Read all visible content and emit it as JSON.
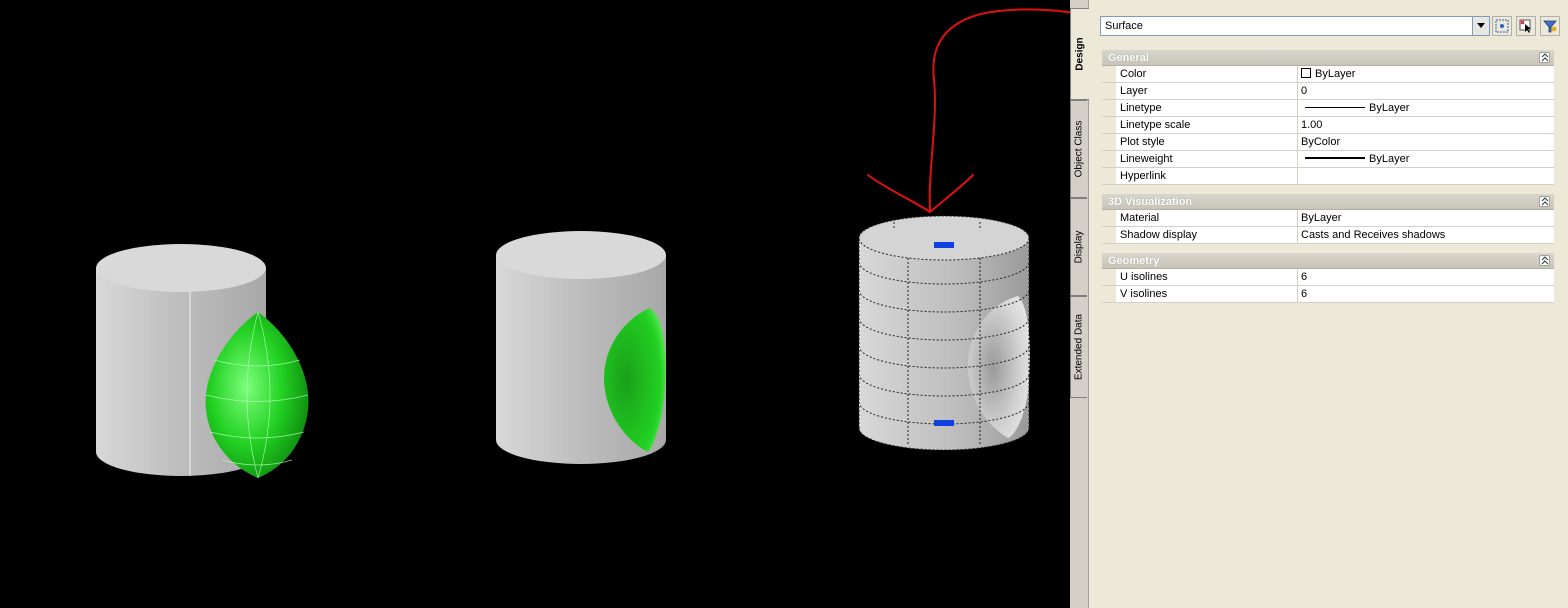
{
  "viewport": {
    "background": "#000000",
    "annotation_color": "#e01010"
  },
  "properties": {
    "selection_type": "Surface",
    "toolbar": [
      "quick-select-icon",
      "select-objects-icon",
      "toggle-pickadd-icon"
    ],
    "tabs": [
      {
        "label": "Design",
        "active": true
      },
      {
        "label": "Object Class",
        "active": false
      },
      {
        "label": "Display",
        "active": false
      },
      {
        "label": "Extended Data",
        "active": false
      }
    ],
    "sections": {
      "general": {
        "title": "General",
        "rows": [
          {
            "name": "Color",
            "value": "ByLayer"
          },
          {
            "name": "Layer",
            "value": "0"
          },
          {
            "name": "Linetype",
            "value": "ByLayer"
          },
          {
            "name": "Linetype scale",
            "value": "1.00"
          },
          {
            "name": "Plot style",
            "value": "ByColor"
          },
          {
            "name": "Lineweight",
            "value": "ByLayer"
          },
          {
            "name": "Hyperlink",
            "value": ""
          }
        ]
      },
      "visualization": {
        "title": "3D Visualization",
        "rows": [
          {
            "name": "Material",
            "value": "ByLayer"
          },
          {
            "name": "Shadow display",
            "value": "Casts and Receives shadows"
          }
        ]
      },
      "geometry": {
        "title": "Geometry",
        "rows": [
          {
            "name": "U isolines",
            "value": "6"
          },
          {
            "name": "V isolines",
            "value": "6"
          }
        ]
      }
    }
  }
}
